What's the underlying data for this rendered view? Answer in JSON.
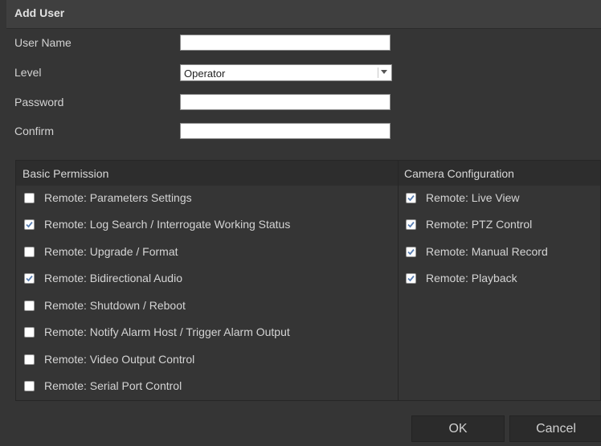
{
  "dialog": {
    "title": "Add User"
  },
  "form": {
    "username_label": "User Name",
    "username_value": "",
    "level_label": "Level",
    "level_value": "Operator",
    "password_label": "Password",
    "password_value": "",
    "confirm_label": "Confirm",
    "confirm_value": ""
  },
  "basic_permission": {
    "header": "Basic Permission",
    "items": [
      {
        "label": "Remote: Parameters Settings",
        "checked": false
      },
      {
        "label": "Remote: Log Search / Interrogate Working Status",
        "checked": true
      },
      {
        "label": "Remote: Upgrade / Format",
        "checked": false
      },
      {
        "label": "Remote: Bidirectional Audio",
        "checked": true
      },
      {
        "label": "Remote: Shutdown / Reboot",
        "checked": false
      },
      {
        "label": "Remote: Notify Alarm Host / Trigger Alarm Output",
        "checked": false
      },
      {
        "label": "Remote: Video Output Control",
        "checked": false
      },
      {
        "label": "Remote: Serial Port Control",
        "checked": false
      }
    ]
  },
  "camera_configuration": {
    "header": "Camera Configuration",
    "items": [
      {
        "label": "Remote: Live View",
        "checked": true
      },
      {
        "label": "Remote: PTZ Control",
        "checked": true
      },
      {
        "label": "Remote: Manual Record",
        "checked": true
      },
      {
        "label": "Remote: Playback",
        "checked": true
      }
    ]
  },
  "buttons": {
    "ok": "OK",
    "cancel": "Cancel"
  },
  "colors": {
    "background": "#353535",
    "check_color": "#5a7fb3"
  },
  "icons": {
    "select_arrow": "chevron-down-icon",
    "check": "checkmark-icon"
  }
}
